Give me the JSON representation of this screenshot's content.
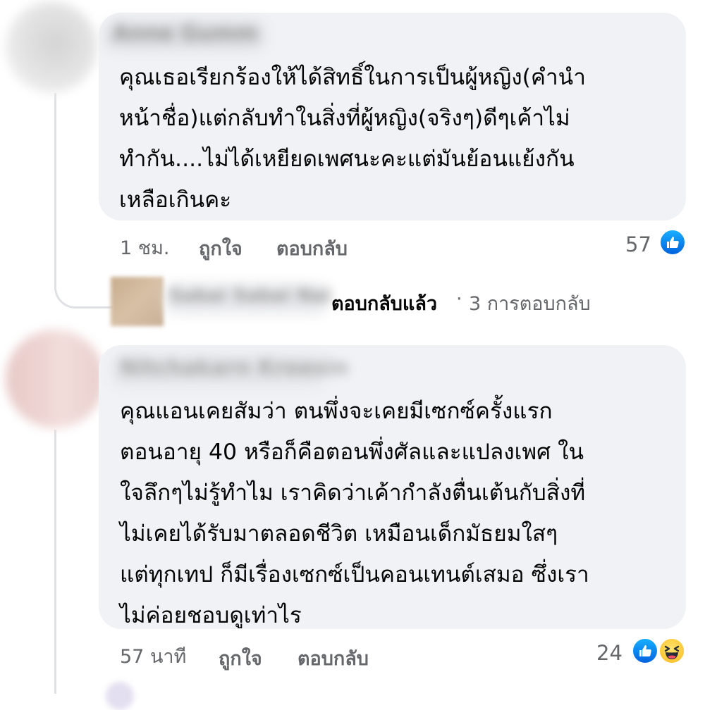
{
  "comments": [
    {
      "author": "Anne Gumm",
      "lines": [
        "คุณเธอเรียกร้องให้ได้สิทธิ์ในการเป็นผู้หญิง(คำนำ",
        "หน้าชื่อ)แต่กลับทำในสิ่งที่ผู้หญิง(จริงๆ)ดีๆเค้าไม่",
        "ทำกัน....ไม่ได้เหยียดเพศนะคะแต่มันย้อนแย้งกัน",
        "เหลือเกินคะ"
      ],
      "time": "1 ชม.",
      "like_label": "ถูกใจ",
      "reply_label": "ตอบกลับ",
      "reaction_count": "57",
      "reactions": [
        "like-icon"
      ],
      "replies": {
        "author": "Sabai Sabai Nai",
        "replied_label": "ตอบกลับแล้ว",
        "separator": "·",
        "count_label": "3 การตอบกลับ"
      }
    },
    {
      "author": "Nitchakarn Kreesin",
      "lines": [
        "คุณแอนเคยสัมว่า ตนพึ่งจะเคยมีเซกซ์ครั้งแรก",
        "ตอนอายุ 40 หรือก็คือตอนพึ่งศัลและแปลงเพศ ใน",
        "ใจลึกๆไม่รู้ทำไม เราคิดว่าเค้ากำลังตื่นเต้นกับสิ่งที่",
        "ไม่เคยได้รับมาตลอดชีวิต เหมือนเด็กมัธยมใสๆ",
        "แต่ทุกเทป ก็มีเรื่องเซกซ์เป็นคอนเทนต์เสมอ ซึ่งเรา",
        "ไม่ค่อยชอบดูเท่าไร"
      ],
      "time": "57 นาที",
      "like_label": "ถูกใจ",
      "reply_label": "ตอบกลับ",
      "reaction_count": "24",
      "reactions": [
        "like-icon",
        "haha-icon"
      ]
    }
  ],
  "colors": {
    "bubble": "#f0f2f5",
    "meta_text": "#65676b",
    "body_text": "#050505",
    "like_blue": "#1877f2"
  }
}
